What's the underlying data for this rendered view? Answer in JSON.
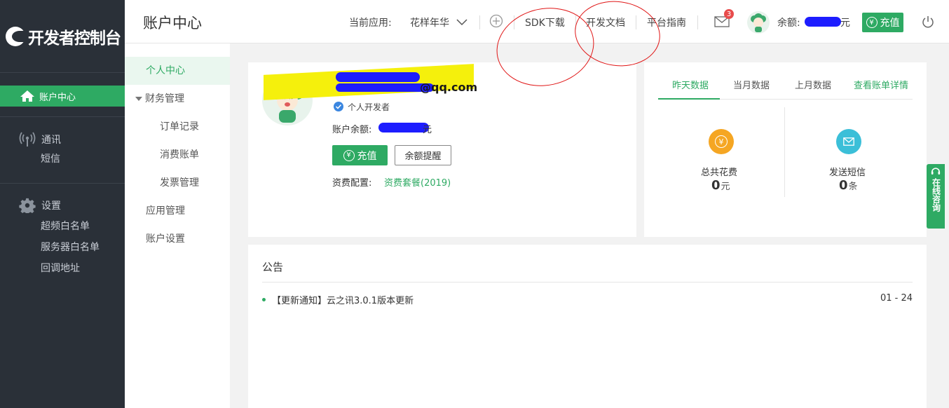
{
  "sidebar": {
    "logo_text": "开发者控制台",
    "active_item": "账户中心",
    "groups": [
      {
        "title": "通讯",
        "icon": "antenna-icon",
        "items": [
          "短信"
        ]
      },
      {
        "title": "设置",
        "icon": "gear-icon",
        "items": [
          "超频白名单",
          "服务器白名单",
          "回调地址"
        ]
      }
    ]
  },
  "submenu": {
    "items": [
      {
        "label": "个人中心",
        "active": true,
        "indent": 0
      },
      {
        "label": "财务管理",
        "expanded": true,
        "indent": 0
      },
      {
        "label": "订单记录",
        "indent": 1
      },
      {
        "label": "消费账单",
        "indent": 1
      },
      {
        "label": "发票管理",
        "indent": 1
      },
      {
        "label": "应用管理",
        "indent": 0
      },
      {
        "label": "账户设置",
        "indent": 0
      }
    ]
  },
  "header": {
    "title": "账户中心",
    "current_app_label": "当前应用:",
    "current_app_value": "花样年华",
    "links": [
      "SDK下载",
      "开发文档",
      "平台指南"
    ],
    "mail_badge": "3",
    "balance_label": "余额:",
    "balance_unit": "元",
    "recharge_label": "充值"
  },
  "profile": {
    "email_suffix": "@qq.com",
    "verified_label": "个人开发者",
    "balance_label": "账户余额:",
    "balance_unit": "元",
    "recharge_label": "充值",
    "reminder_label": "余额提醒",
    "plan_label": "资费配置:",
    "plan_value": "资费套餐(2019)"
  },
  "stats": {
    "tabs": [
      "昨天数据",
      "当月数据",
      "上月数据"
    ],
    "detail_link": "查看账单详情",
    "items": [
      {
        "label": "总共花费",
        "value": "0",
        "unit": "元",
        "icon": "yen-icon",
        "color": "#f5a623"
      },
      {
        "label": "发送短信",
        "value": "0",
        "unit": "条",
        "icon": "mail-icon",
        "color": "#3bbfd8"
      }
    ]
  },
  "notice": {
    "title": "公告",
    "items": [
      {
        "text": "【更新通知】云之讯3.0.1版本更新",
        "date": "01 - 24"
      }
    ]
  },
  "consult": {
    "label": "在线咨询"
  },
  "colors": {
    "brand": "#2eaa63",
    "sidebar": "#2a3038"
  }
}
